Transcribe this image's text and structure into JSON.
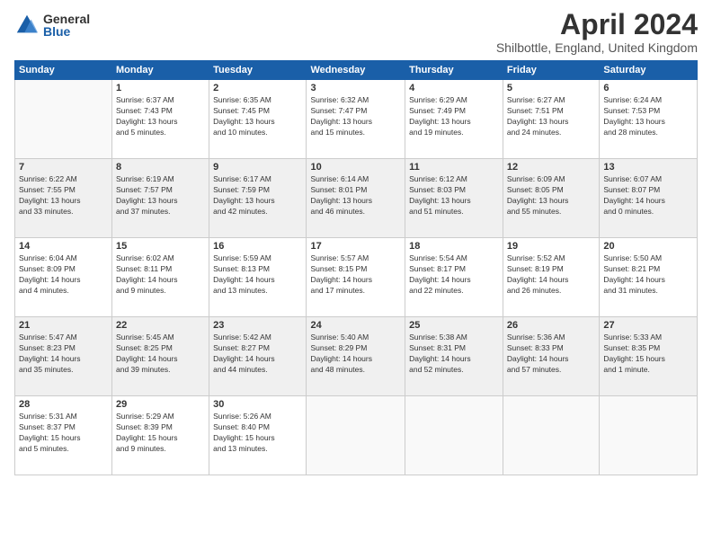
{
  "logo": {
    "general": "General",
    "blue": "Blue"
  },
  "header": {
    "title": "April 2024",
    "subtitle": "Shilbottle, England, United Kingdom"
  },
  "weekdays": [
    "Sunday",
    "Monday",
    "Tuesday",
    "Wednesday",
    "Thursday",
    "Friday",
    "Saturday"
  ],
  "weeks": [
    [
      {
        "day": "",
        "info": ""
      },
      {
        "day": "1",
        "info": "Sunrise: 6:37 AM\nSunset: 7:43 PM\nDaylight: 13 hours\nand 5 minutes."
      },
      {
        "day": "2",
        "info": "Sunrise: 6:35 AM\nSunset: 7:45 PM\nDaylight: 13 hours\nand 10 minutes."
      },
      {
        "day": "3",
        "info": "Sunrise: 6:32 AM\nSunset: 7:47 PM\nDaylight: 13 hours\nand 15 minutes."
      },
      {
        "day": "4",
        "info": "Sunrise: 6:29 AM\nSunset: 7:49 PM\nDaylight: 13 hours\nand 19 minutes."
      },
      {
        "day": "5",
        "info": "Sunrise: 6:27 AM\nSunset: 7:51 PM\nDaylight: 13 hours\nand 24 minutes."
      },
      {
        "day": "6",
        "info": "Sunrise: 6:24 AM\nSunset: 7:53 PM\nDaylight: 13 hours\nand 28 minutes."
      }
    ],
    [
      {
        "day": "7",
        "info": "Sunrise: 6:22 AM\nSunset: 7:55 PM\nDaylight: 13 hours\nand 33 minutes."
      },
      {
        "day": "8",
        "info": "Sunrise: 6:19 AM\nSunset: 7:57 PM\nDaylight: 13 hours\nand 37 minutes."
      },
      {
        "day": "9",
        "info": "Sunrise: 6:17 AM\nSunset: 7:59 PM\nDaylight: 13 hours\nand 42 minutes."
      },
      {
        "day": "10",
        "info": "Sunrise: 6:14 AM\nSunset: 8:01 PM\nDaylight: 13 hours\nand 46 minutes."
      },
      {
        "day": "11",
        "info": "Sunrise: 6:12 AM\nSunset: 8:03 PM\nDaylight: 13 hours\nand 51 minutes."
      },
      {
        "day": "12",
        "info": "Sunrise: 6:09 AM\nSunset: 8:05 PM\nDaylight: 13 hours\nand 55 minutes."
      },
      {
        "day": "13",
        "info": "Sunrise: 6:07 AM\nSunset: 8:07 PM\nDaylight: 14 hours\nand 0 minutes."
      }
    ],
    [
      {
        "day": "14",
        "info": "Sunrise: 6:04 AM\nSunset: 8:09 PM\nDaylight: 14 hours\nand 4 minutes."
      },
      {
        "day": "15",
        "info": "Sunrise: 6:02 AM\nSunset: 8:11 PM\nDaylight: 14 hours\nand 9 minutes."
      },
      {
        "day": "16",
        "info": "Sunrise: 5:59 AM\nSunset: 8:13 PM\nDaylight: 14 hours\nand 13 minutes."
      },
      {
        "day": "17",
        "info": "Sunrise: 5:57 AM\nSunset: 8:15 PM\nDaylight: 14 hours\nand 17 minutes."
      },
      {
        "day": "18",
        "info": "Sunrise: 5:54 AM\nSunset: 8:17 PM\nDaylight: 14 hours\nand 22 minutes."
      },
      {
        "day": "19",
        "info": "Sunrise: 5:52 AM\nSunset: 8:19 PM\nDaylight: 14 hours\nand 26 minutes."
      },
      {
        "day": "20",
        "info": "Sunrise: 5:50 AM\nSunset: 8:21 PM\nDaylight: 14 hours\nand 31 minutes."
      }
    ],
    [
      {
        "day": "21",
        "info": "Sunrise: 5:47 AM\nSunset: 8:23 PM\nDaylight: 14 hours\nand 35 minutes."
      },
      {
        "day": "22",
        "info": "Sunrise: 5:45 AM\nSunset: 8:25 PM\nDaylight: 14 hours\nand 39 minutes."
      },
      {
        "day": "23",
        "info": "Sunrise: 5:42 AM\nSunset: 8:27 PM\nDaylight: 14 hours\nand 44 minutes."
      },
      {
        "day": "24",
        "info": "Sunrise: 5:40 AM\nSunset: 8:29 PM\nDaylight: 14 hours\nand 48 minutes."
      },
      {
        "day": "25",
        "info": "Sunrise: 5:38 AM\nSunset: 8:31 PM\nDaylight: 14 hours\nand 52 minutes."
      },
      {
        "day": "26",
        "info": "Sunrise: 5:36 AM\nSunset: 8:33 PM\nDaylight: 14 hours\nand 57 minutes."
      },
      {
        "day": "27",
        "info": "Sunrise: 5:33 AM\nSunset: 8:35 PM\nDaylight: 15 hours\nand 1 minute."
      }
    ],
    [
      {
        "day": "28",
        "info": "Sunrise: 5:31 AM\nSunset: 8:37 PM\nDaylight: 15 hours\nand 5 minutes."
      },
      {
        "day": "29",
        "info": "Sunrise: 5:29 AM\nSunset: 8:39 PM\nDaylight: 15 hours\nand 9 minutes."
      },
      {
        "day": "30",
        "info": "Sunrise: 5:26 AM\nSunset: 8:40 PM\nDaylight: 15 hours\nand 13 minutes."
      },
      {
        "day": "",
        "info": ""
      },
      {
        "day": "",
        "info": ""
      },
      {
        "day": "",
        "info": ""
      },
      {
        "day": "",
        "info": ""
      }
    ]
  ]
}
